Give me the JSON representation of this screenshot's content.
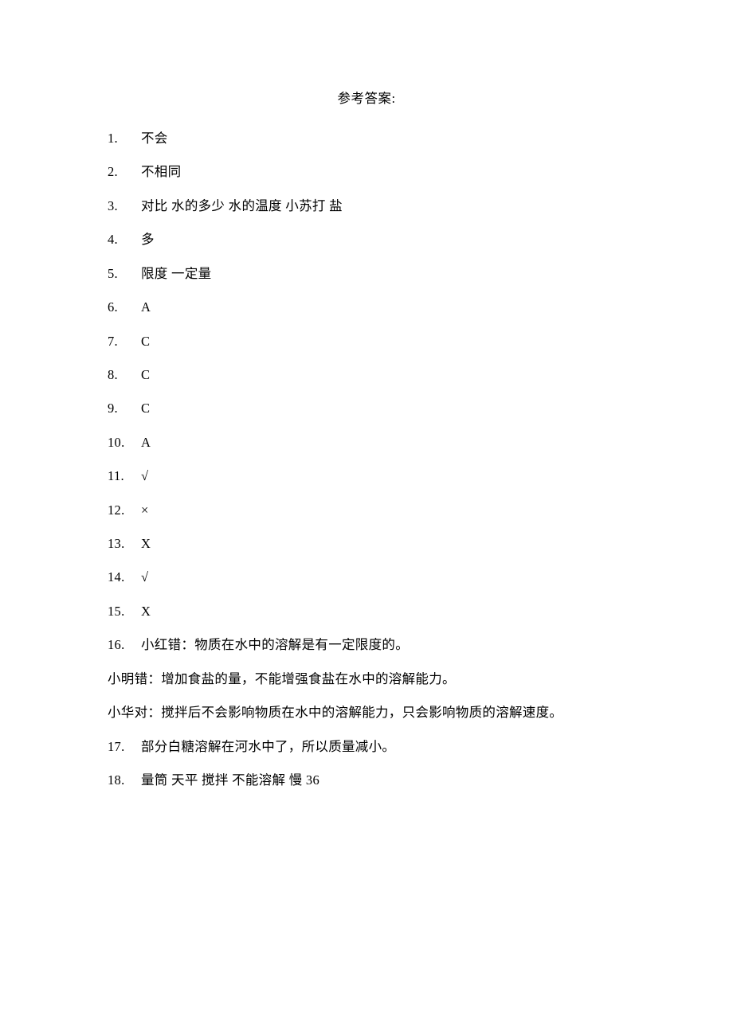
{
  "title": "参考答案:",
  "answers": [
    {
      "num": "1. ",
      "text": "不会"
    },
    {
      "num": "2. ",
      "text": "不相同"
    },
    {
      "num": "3. ",
      "text": "对比 水的多少  水的温度      小苏打 盐"
    },
    {
      "num": "4. ",
      "text": "多"
    },
    {
      "num": "5. ",
      "text": "限度 一定量"
    },
    {
      "num": "6. ",
      "text": "A"
    },
    {
      "num": "7. ",
      "text": "C"
    },
    {
      "num": "8. ",
      "text": "C"
    },
    {
      "num": "9. ",
      "text": "C"
    },
    {
      "num": "10. ",
      "text": "A"
    },
    {
      "num": "11. ",
      "text": "√"
    },
    {
      "num": "12. ",
      "text": "×"
    },
    {
      "num": "13. ",
      "text": "X"
    },
    {
      "num": "14. ",
      "text": "√"
    },
    {
      "num": "15. ",
      "text": "X"
    },
    {
      "num": "16. ",
      "text": "小红错：物质在水中的溶解是有一定限度的。"
    },
    {
      "num": "",
      "text": "小明错：增加食盐的量，不能增强食盐在水中的溶解能力。"
    },
    {
      "num": "",
      "text": "小华对：搅拌后不会影响物质在水中的溶解能力，只会影响物质的溶解速度。"
    },
    {
      "num": "17. ",
      "text": "部分白糖溶解在河水中了，所以质量减小。"
    },
    {
      "num": "18. ",
      "text": "量筒 天平 搅拌 不能溶解 慢 36"
    }
  ]
}
